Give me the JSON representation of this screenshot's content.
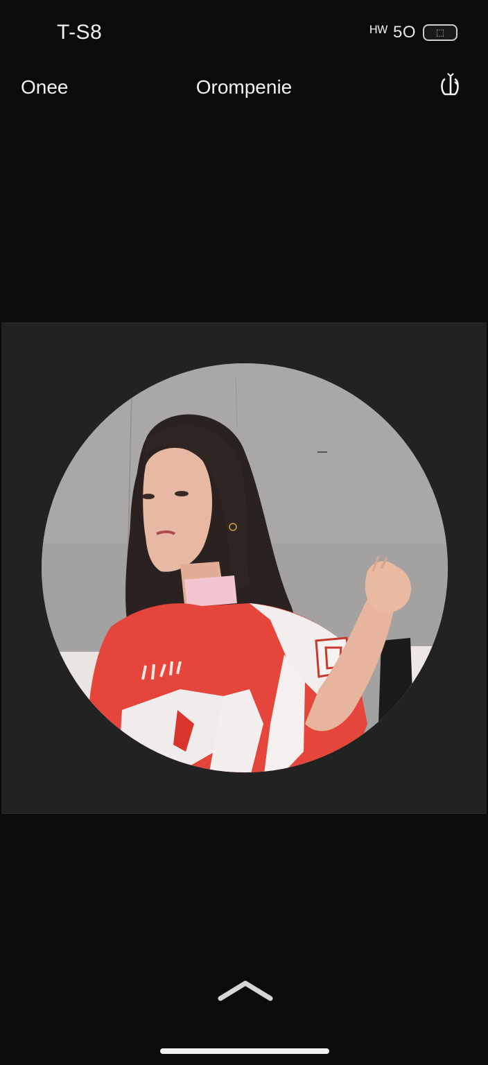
{
  "status_bar": {
    "time": "T-S8",
    "signal_text": "ᴴᵂ 5O",
    "battery_label": "⬚"
  },
  "nav": {
    "left_label": "Onee",
    "title": "Orompenie",
    "right_icon": "rotate-icon"
  },
  "editor": {
    "image_alt": "",
    "crop_shape": "circle"
  },
  "bottom": {
    "expand_icon": "chevron-up-icon"
  },
  "colors": {
    "background": "#0b0b0c",
    "panel": "#222223",
    "jersey_red": "#e6453c",
    "wall_gray": "#9c9c9c"
  }
}
